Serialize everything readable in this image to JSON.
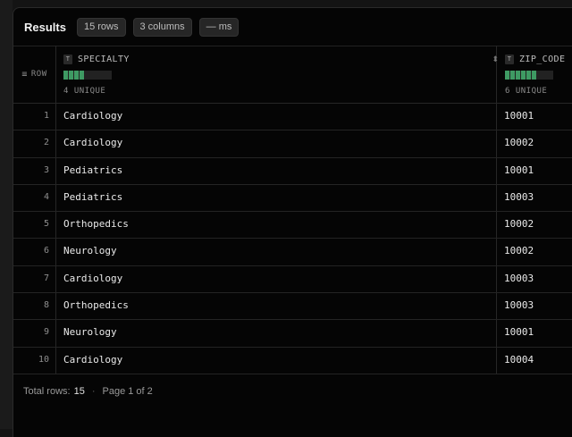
{
  "header": {
    "title": "Results",
    "row_count": "15 rows",
    "col_count": "3 columns",
    "time": "— ms"
  },
  "columns": {
    "row_label": "ROW",
    "specialty": {
      "name": "SPECIALTY",
      "type": "T",
      "unique": "4 UNIQUE",
      "unique_bars": 4
    },
    "zip_code": {
      "name": "ZIP_CODE",
      "type": "T",
      "unique": "6 UNIQUE",
      "unique_bars": 6
    }
  },
  "rows": [
    {
      "n": "1",
      "specialty": "Cardiology",
      "zip": "10001"
    },
    {
      "n": "2",
      "specialty": "Cardiology",
      "zip": "10002"
    },
    {
      "n": "3",
      "specialty": "Pediatrics",
      "zip": "10001"
    },
    {
      "n": "4",
      "specialty": "Pediatrics",
      "zip": "10003"
    },
    {
      "n": "5",
      "specialty": "Orthopedics",
      "zip": "10002"
    },
    {
      "n": "6",
      "specialty": "Neurology",
      "zip": "10002"
    },
    {
      "n": "7",
      "specialty": "Cardiology",
      "zip": "10003"
    },
    {
      "n": "8",
      "specialty": "Orthopedics",
      "zip": "10003"
    },
    {
      "n": "9",
      "specialty": "Neurology",
      "zip": "10001"
    },
    {
      "n": "10",
      "specialty": "Cardiology",
      "zip": "10004"
    }
  ],
  "footer": {
    "total_label": "Total rows:",
    "total_value": "15",
    "separator": "·",
    "page": "Page 1 of 2"
  },
  "colors": {
    "accent_bar": "#3e9a63",
    "panel_bg": "#050505"
  },
  "icons": {
    "row_header": "rows-icon",
    "sort": "sort-icon",
    "type": "text-type-icon"
  }
}
